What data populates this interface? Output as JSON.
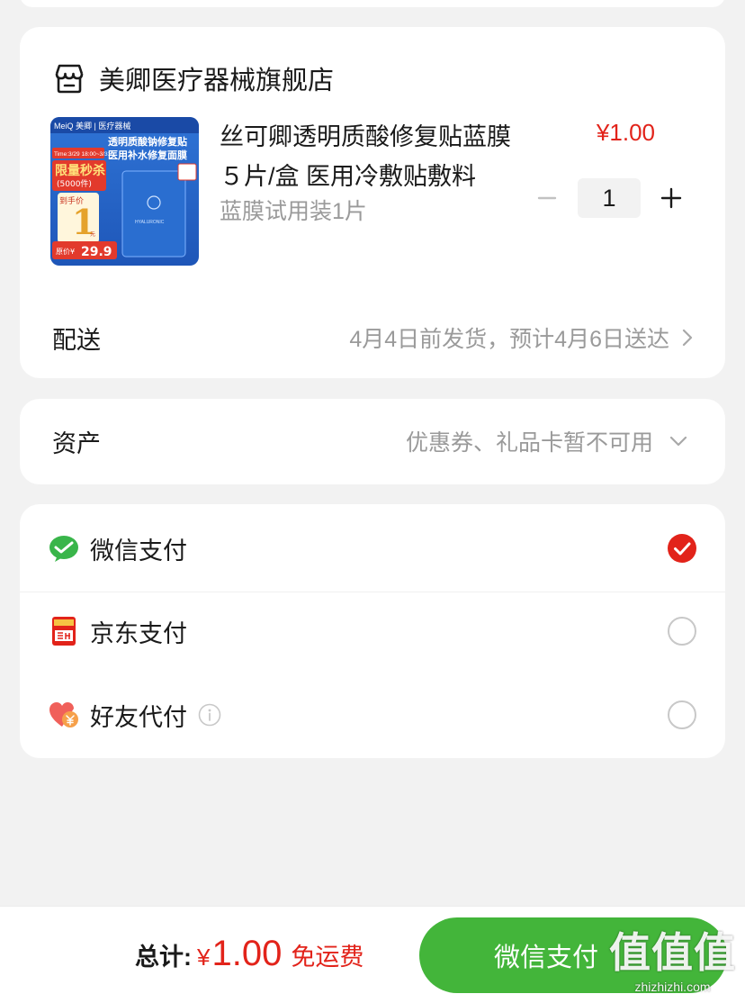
{
  "shop": {
    "name": "美卿医疗器械旗舰店"
  },
  "product": {
    "title": "丝可卿透明质酸修复贴蓝膜５片/盒 医用冷敷贴敷料",
    "spec": "蓝膜试用装1片",
    "price": "¥1.00",
    "quantity": "1",
    "image": {
      "brand": "MeiQ 美卿 | 医疗器械",
      "headline_1": "透明质酸钠修复贴",
      "headline_2": "医用补水修复面膜",
      "time": "Time:3/29 18:00~3/31",
      "flash": "限量秒杀",
      "flash_count": "(5000件)",
      "to_hand": "到手价",
      "big_price": "1",
      "yuan": "元",
      "original": "原价¥",
      "original_price": "29.9",
      "pack_text": "HYALURONIC"
    }
  },
  "delivery": {
    "label": "配送",
    "value": "4月4日前发货，预计4月6日送达"
  },
  "assets": {
    "label": "资产",
    "value": "优惠券、礼品卡暂不可用"
  },
  "payment": {
    "options": [
      {
        "label": "微信支付",
        "icon": "wechat-pay-icon",
        "selected": true
      },
      {
        "label": "京东支付",
        "icon": "jd-pay-icon",
        "selected": false
      },
      {
        "label": "好友代付",
        "icon": "friend-pay-icon",
        "selected": false
      }
    ]
  },
  "footer": {
    "total_label": "总计:",
    "currency": "¥",
    "total_amount": "1.00",
    "shipping": "免运费",
    "pay_button": "微信支付"
  },
  "watermark": {
    "logo": "值值值",
    "url": "zhizhizhi.com"
  },
  "colors": {
    "accent_red": "#e2231a",
    "wechat_green": "#43b53a",
    "background": "#f2f2f2"
  }
}
